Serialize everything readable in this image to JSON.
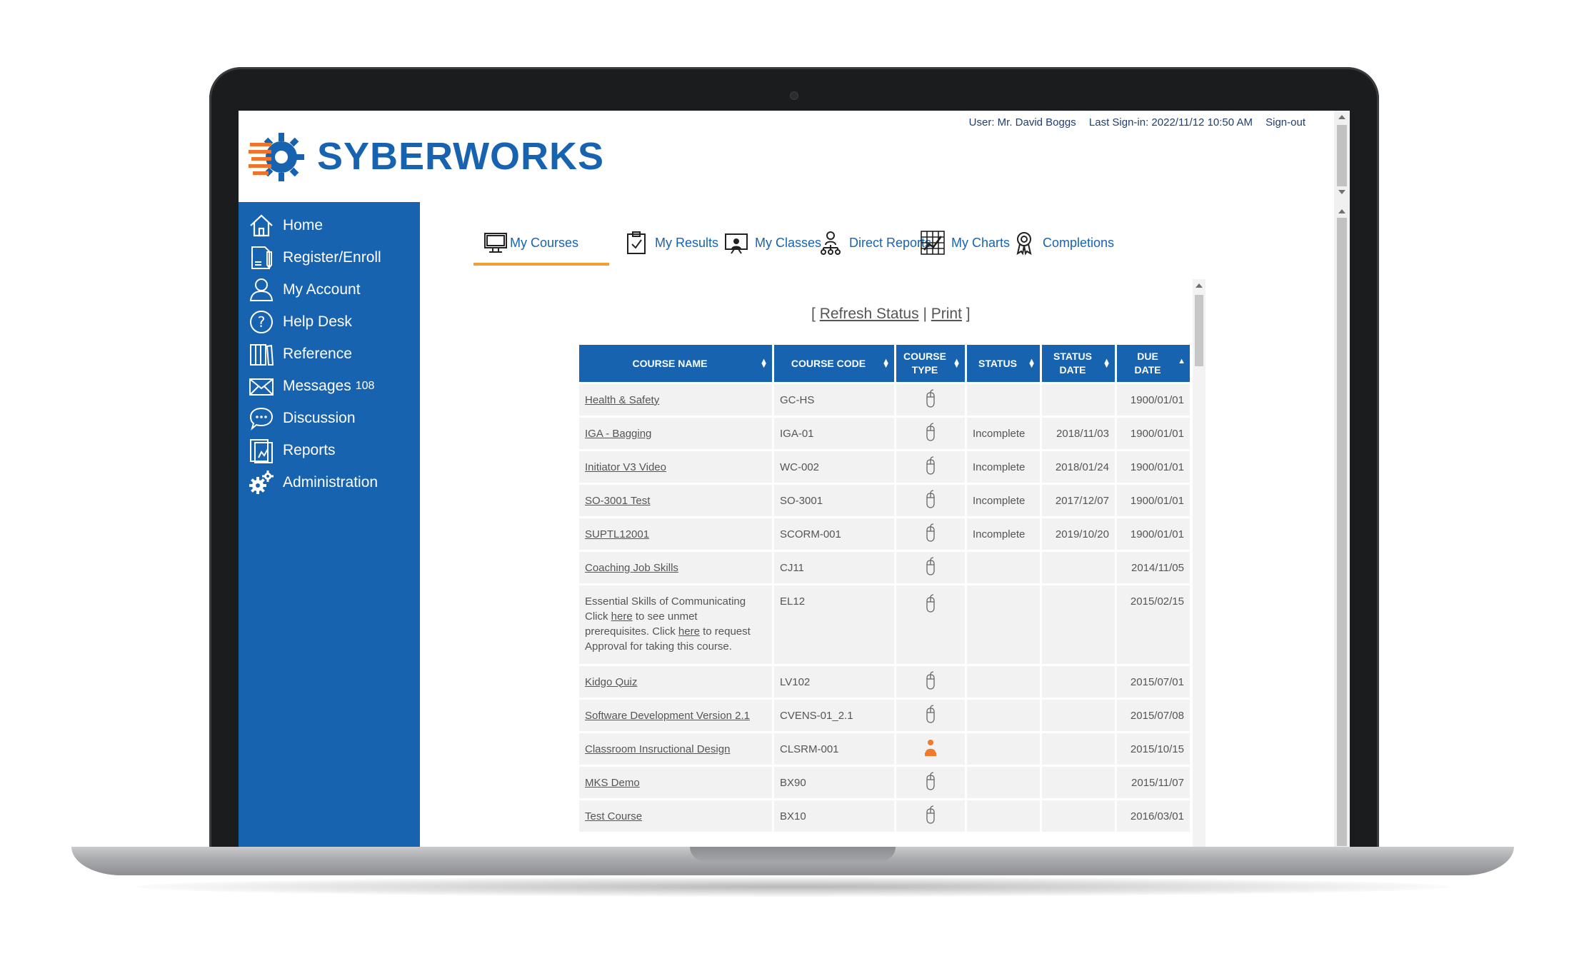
{
  "brand": {
    "name": "SYBERWORKS"
  },
  "header": {
    "user": "User: Mr. David Boggs",
    "last_signin": "Last Sign-in: 2022/11/12 10:50 AM",
    "signout": "Sign-out"
  },
  "sidebar": {
    "items": [
      {
        "label": "Home",
        "icon": "home-icon"
      },
      {
        "label": "Register/Enroll",
        "icon": "register-icon"
      },
      {
        "label": "My Account",
        "icon": "user-icon"
      },
      {
        "label": "Help Desk",
        "icon": "help-icon"
      },
      {
        "label": "Reference",
        "icon": "books-icon"
      },
      {
        "label": "Messages",
        "count": "108",
        "icon": "envelope-icon"
      },
      {
        "label": "Discussion",
        "icon": "chat-icon"
      },
      {
        "label": "Reports",
        "icon": "reports-icon"
      },
      {
        "label": "Administration",
        "icon": "gears-icon"
      }
    ]
  },
  "tabs": [
    {
      "label": "My Courses",
      "icon": "monitor-icon",
      "active": true
    },
    {
      "label": "My Results",
      "icon": "clipboard-check-icon"
    },
    {
      "label": "My Classes",
      "icon": "presentation-icon"
    },
    {
      "label": "Direct Reports",
      "icon": "org-chart-icon"
    },
    {
      "label": "My Charts",
      "icon": "chart-icon"
    },
    {
      "label": "Completions",
      "icon": "award-icon"
    }
  ],
  "actions": {
    "open": "[",
    "refresh": "Refresh Status",
    "sep": "|",
    "print": "Print",
    "close": "]"
  },
  "table": {
    "headers": {
      "name": "COURSE NAME",
      "code": "COURSE CODE",
      "type_l1": "COURSE",
      "type_l2": "TYPE",
      "status": "STATUS",
      "sdate_l1": "STATUS",
      "sdate_l2": "DATE",
      "ddate_l1": "DUE",
      "ddate_l2": "DATE"
    },
    "rows": [
      {
        "name": "Health & Safety",
        "code": "GC-HS",
        "type": "mouse",
        "status": "",
        "status_date": "",
        "due_date": "1900/01/01"
      },
      {
        "name": "IGA - Bagging",
        "code": "IGA-01",
        "type": "mouse",
        "status": "Incomplete",
        "status_date": "2018/11/03",
        "due_date": "1900/01/01"
      },
      {
        "name": "Initiator V3 Video",
        "code": "WC-002",
        "type": "mouse",
        "status": "Incomplete",
        "status_date": "2018/01/24",
        "due_date": "1900/01/01"
      },
      {
        "name": "SO-3001 Test",
        "code": "SO-3001",
        "type": "mouse",
        "status": "Incomplete",
        "status_date": "2017/12/07",
        "due_date": "1900/01/01"
      },
      {
        "name": "SUPTL12001",
        "code": "SCORM-001",
        "type": "mouse",
        "status": "Incomplete",
        "status_date": "2019/10/20",
        "due_date": "1900/01/01"
      },
      {
        "name": "Coaching Job Skills",
        "code": "CJ11",
        "type": "mouse",
        "status": "",
        "status_date": "",
        "due_date": "2014/11/05"
      },
      {
        "name": "Kidgo Quiz",
        "code": "LV102",
        "type": "mouse",
        "status": "",
        "status_date": "",
        "due_date": "2015/07/01"
      },
      {
        "name": "Software Development Version 2.1",
        "code": "CVENS-01_2.1",
        "type": "mouse",
        "status": "",
        "status_date": "",
        "due_date": "2015/07/08"
      },
      {
        "name": "Classroom Insructional Design",
        "code": "CLSRM-001",
        "type": "instructor",
        "status": "",
        "status_date": "",
        "due_date": "2015/10/15"
      },
      {
        "name": "MKS Demo",
        "code": "BX90",
        "type": "mouse",
        "status": "",
        "status_date": "",
        "due_date": "2015/11/07"
      },
      {
        "name": "Test Course",
        "code": "BX10",
        "type": "mouse",
        "status": "",
        "status_date": "",
        "due_date": "2016/03/01"
      }
    ],
    "special_row": {
      "name_l1": "Essential Skills of Communicating",
      "click1": "Click",
      "here1": "here",
      "text1": "to see unmet",
      "text2": "prerequisites. Click",
      "here2": "here",
      "text3": "to request",
      "text4": "Approval for taking this course.",
      "code": "EL12",
      "due_date": "2015/02/15"
    }
  }
}
